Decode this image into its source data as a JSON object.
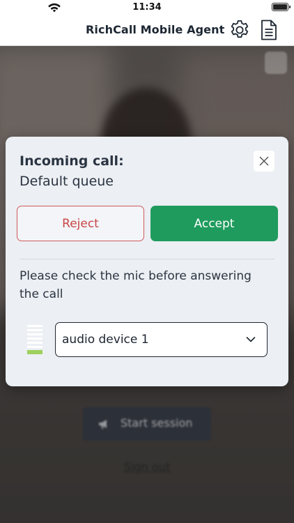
{
  "status_bar": {
    "time": "11:34",
    "icons": [
      "wifi-icon",
      "battery-icon"
    ]
  },
  "header": {
    "title": "RichCall Mobile Agent",
    "icons": [
      "gear-icon",
      "document-icon"
    ]
  },
  "background": {
    "caption": "",
    "start_session_label": "Start session",
    "sign_out_label": "Sign out"
  },
  "modal": {
    "heading": "Incoming call:",
    "subheading": "Default queue",
    "reject_label": "Reject",
    "accept_label": "Accept",
    "mic_note": "Please check the mic before answering the call",
    "device_value": "audio device 1",
    "mic_level": 0.25,
    "colors": {
      "accept": "#1f9b5d",
      "reject": "#c84646",
      "meter_active": "#9ed05f"
    }
  }
}
